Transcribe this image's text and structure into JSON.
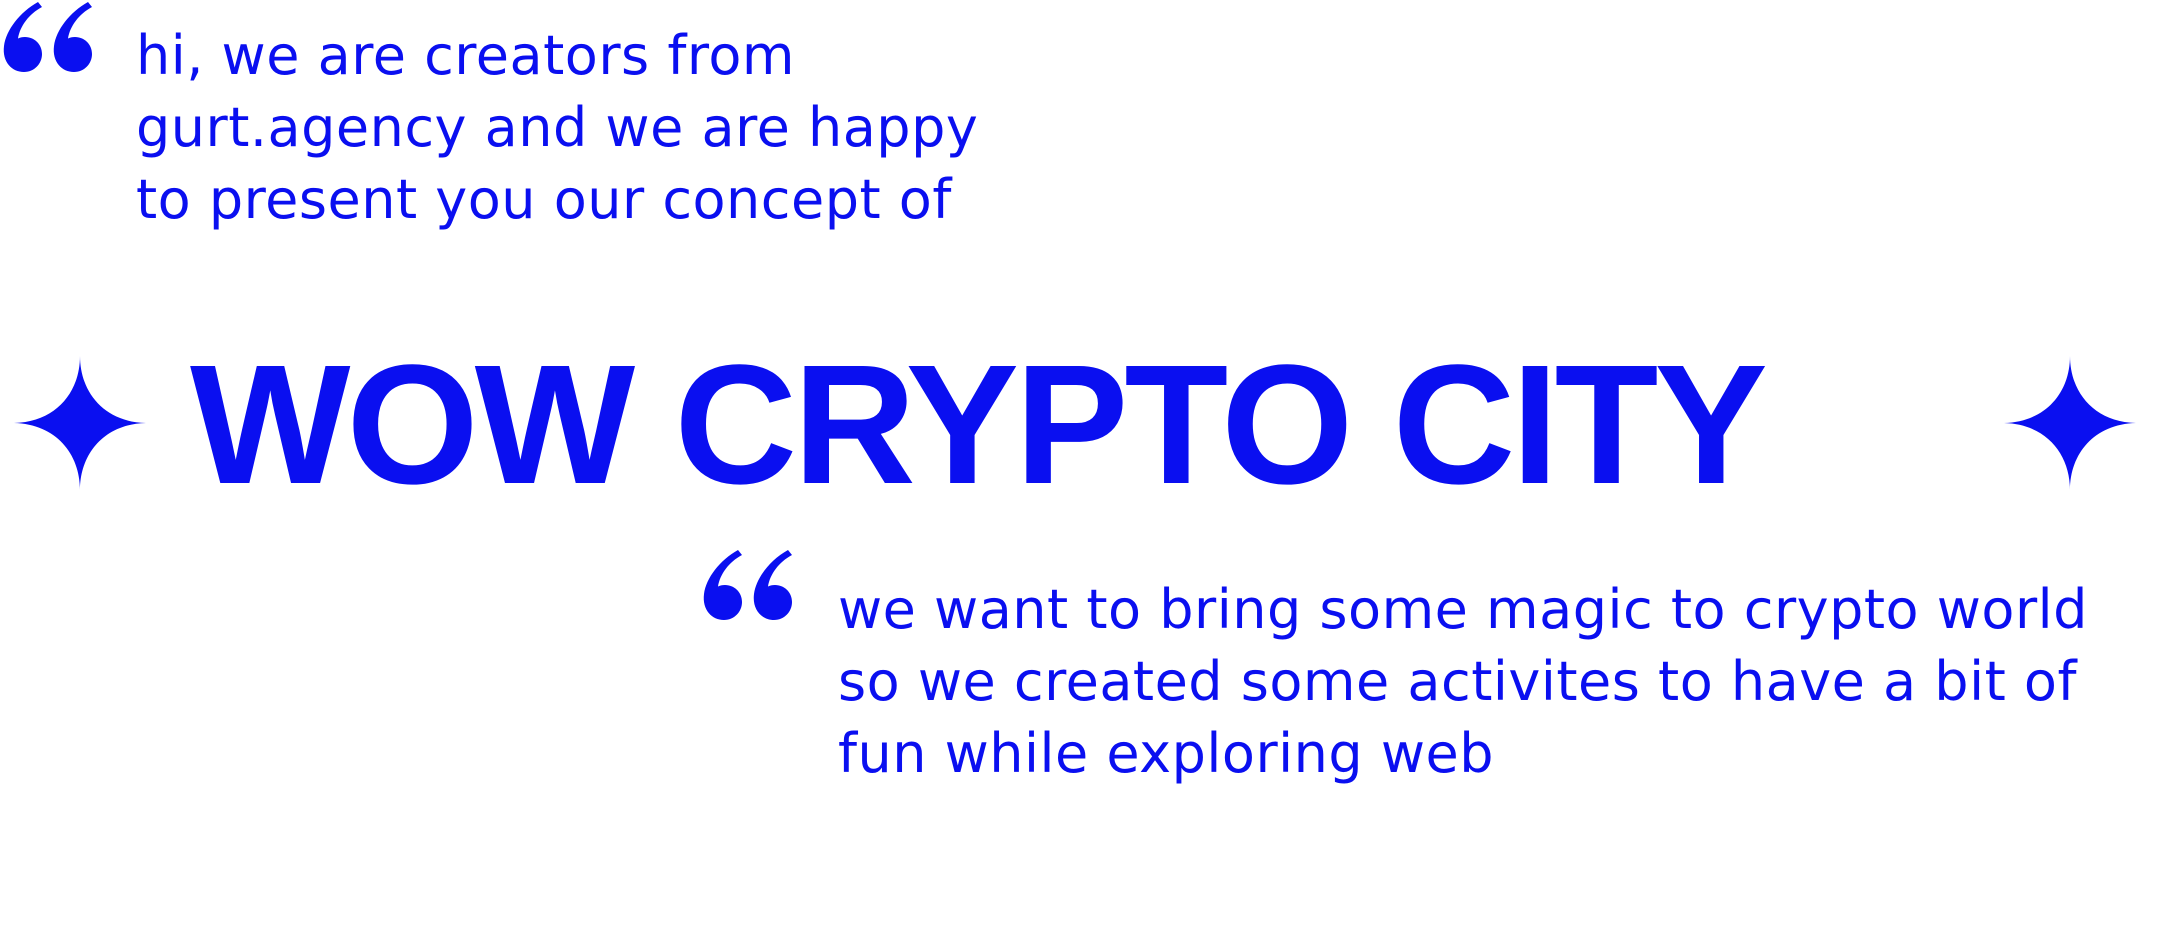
{
  "theme": {
    "accent_color": "#0a0ff0",
    "background_color": "#ffffff"
  },
  "intro": {
    "quote_icon": "opening-quote-icon",
    "lines": [
      "hi, we are creators from",
      "gurt.agency and we are happy",
      "to present you our concept of"
    ]
  },
  "headline": {
    "title": "WOW CRYPTO CITY",
    "left_icon": "four-point-star-icon",
    "right_icon": "four-point-star-icon"
  },
  "mission": {
    "quote_icon": "opening-quote-icon",
    "lines": [
      "we want to bring some magic to crypto world",
      "so we created some activites to have a bit of",
      "fun while exploring web"
    ]
  }
}
